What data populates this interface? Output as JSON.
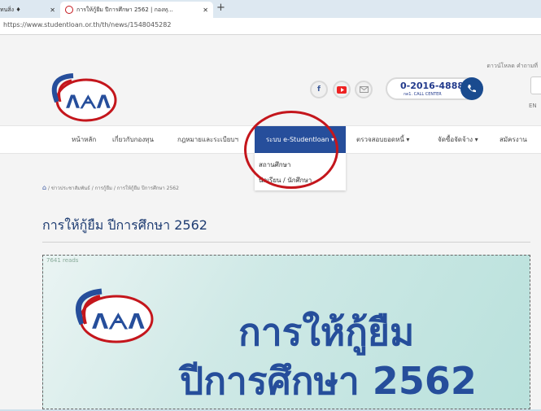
{
  "browser": {
    "tab1_label": "ทนสิ่ง ♦",
    "tab2_label": "การให้กู้ยืม ปีการศึกษา 2562 | กองทุ...",
    "tab_close": "✕",
    "new_tab": "+",
    "url": "https://www.studentloan.or.th/th/news/1548045282"
  },
  "header": {
    "top_links": "ดาวน์โหลด  คำถามที่",
    "call_number": "0-2016-4888",
    "call_sub": "กด1. CALL CENTER",
    "lang": "EN"
  },
  "nav": {
    "items": [
      "หน้าหลัก",
      "เกี่ยวกับกองทุน",
      "กฎหมายและระเบียบฯ",
      "ระบบ e-Studentloan ▾",
      "ตรวจสอบยอดหนี้ ▾",
      "จัดซื้อจัดจ้าง ▾",
      "สมัครงาน"
    ],
    "dropdown": [
      "สถานศึกษา",
      "นักเรียน / นักศึกษา"
    ]
  },
  "breadcrumb": "/  ข่าวประชาสัมพันธ์  /  การกู้ยืม  /  การให้กู้ยืม ปีการศึกษา 2562",
  "title": "การให้กู้ยืม ปีการศึกษา 2562",
  "banner": {
    "reads": "7641 reads",
    "line1": "การให้กู้ยืม",
    "line2": "ปีการศึกษา 2562"
  },
  "colors": {
    "nav_active": "#264e9b",
    "highlight_circle": "#c4161c",
    "brand_blue": "#264e9b"
  }
}
